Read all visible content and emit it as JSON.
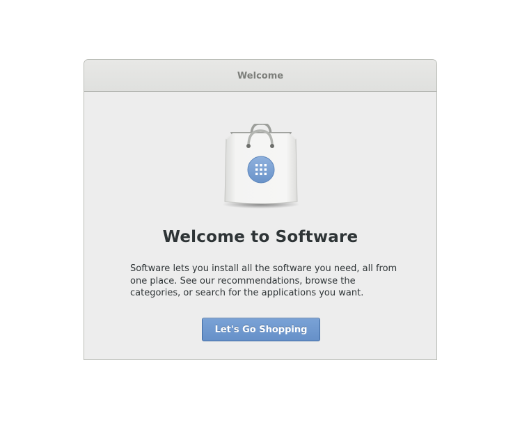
{
  "dialog": {
    "title": "Welcome",
    "icon": "shopping-bag-icon",
    "heading": "Welcome to Software",
    "description": "Software lets you install all the software you need, all from one place. See our recommendations, browse the categories, or search for the applications you want.",
    "button_label": "Let's Go Shopping"
  },
  "colors": {
    "accent": "#6f98cf",
    "titlebar_bg": "#e2e3e1",
    "body_bg": "#ededed",
    "text": "#2e3436",
    "title_text": "#7c7e7a"
  }
}
